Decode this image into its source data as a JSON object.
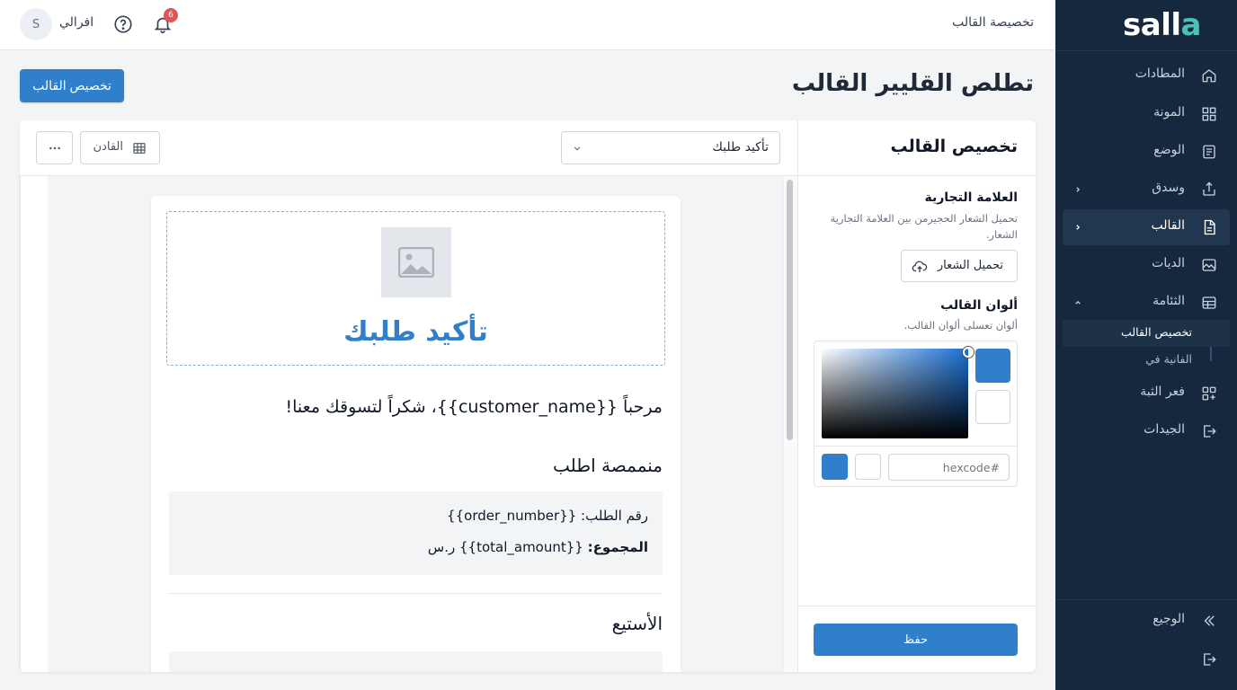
{
  "app": {
    "logo": "salla"
  },
  "topbar": {
    "breadcrumb": "تخصيصة القالب",
    "user_name": "افرالي",
    "avatar_initial": "S",
    "notification_count": "6"
  },
  "sidebar": {
    "items": [
      {
        "label": "المطادات",
        "icon": "home-icon"
      },
      {
        "label": "المونة",
        "icon": "grid-icon"
      },
      {
        "label": "الوضع",
        "icon": "clipboard-icon"
      },
      {
        "label": "وسدق",
        "icon": "share-icon"
      },
      {
        "label": "القالب",
        "icon": "document-icon"
      },
      {
        "label": "الديات",
        "icon": "image-icon"
      },
      {
        "label": "الثئامة",
        "icon": "table-icon"
      }
    ],
    "sub_items": [
      {
        "label": "تخصيص القالب"
      },
      {
        "label": "الفانية في"
      }
    ],
    "bottom_items": [
      {
        "label": "فعر الثبة",
        "icon": "apps-icon"
      },
      {
        "label": "الجيدات",
        "icon": "logout-icon"
      },
      {
        "label": "الوجيع",
        "icon": "collapse-icon"
      }
    ]
  },
  "page": {
    "title": "تطلص القليير القالب",
    "primary_button": "تخصيص القالب"
  },
  "toolbar": {
    "template_select": "تأكيد طلبك",
    "layout_button": "القادن"
  },
  "panel": {
    "title": "تخصيص القالب",
    "brand_title": "العلامة التجارية",
    "brand_desc": "تحميل الشعار الحجيرمن بين العلامة التجارية الشعار.",
    "upload_button": "تحميل الشعار",
    "colors_title": "ألوان القالب",
    "colors_desc": "ألوان تعسلى ألوان القالب.",
    "hex_placeholder": "#hexcode",
    "selected_color": "#2f7fcb",
    "save_button": "حفظ"
  },
  "preview": {
    "hero_title": "تأكيد طلبك",
    "greeting": "مرحباً {{customer_name}}، شكراً لتسوقك معنا!",
    "order_section_title": "منممصة اطلب",
    "order_number_line": "رقم الطلب: {{order_number}}",
    "total_label": "المجموع:",
    "total_value": "{{total_amount}} ر.س",
    "next_section_title": "الأستيع"
  }
}
